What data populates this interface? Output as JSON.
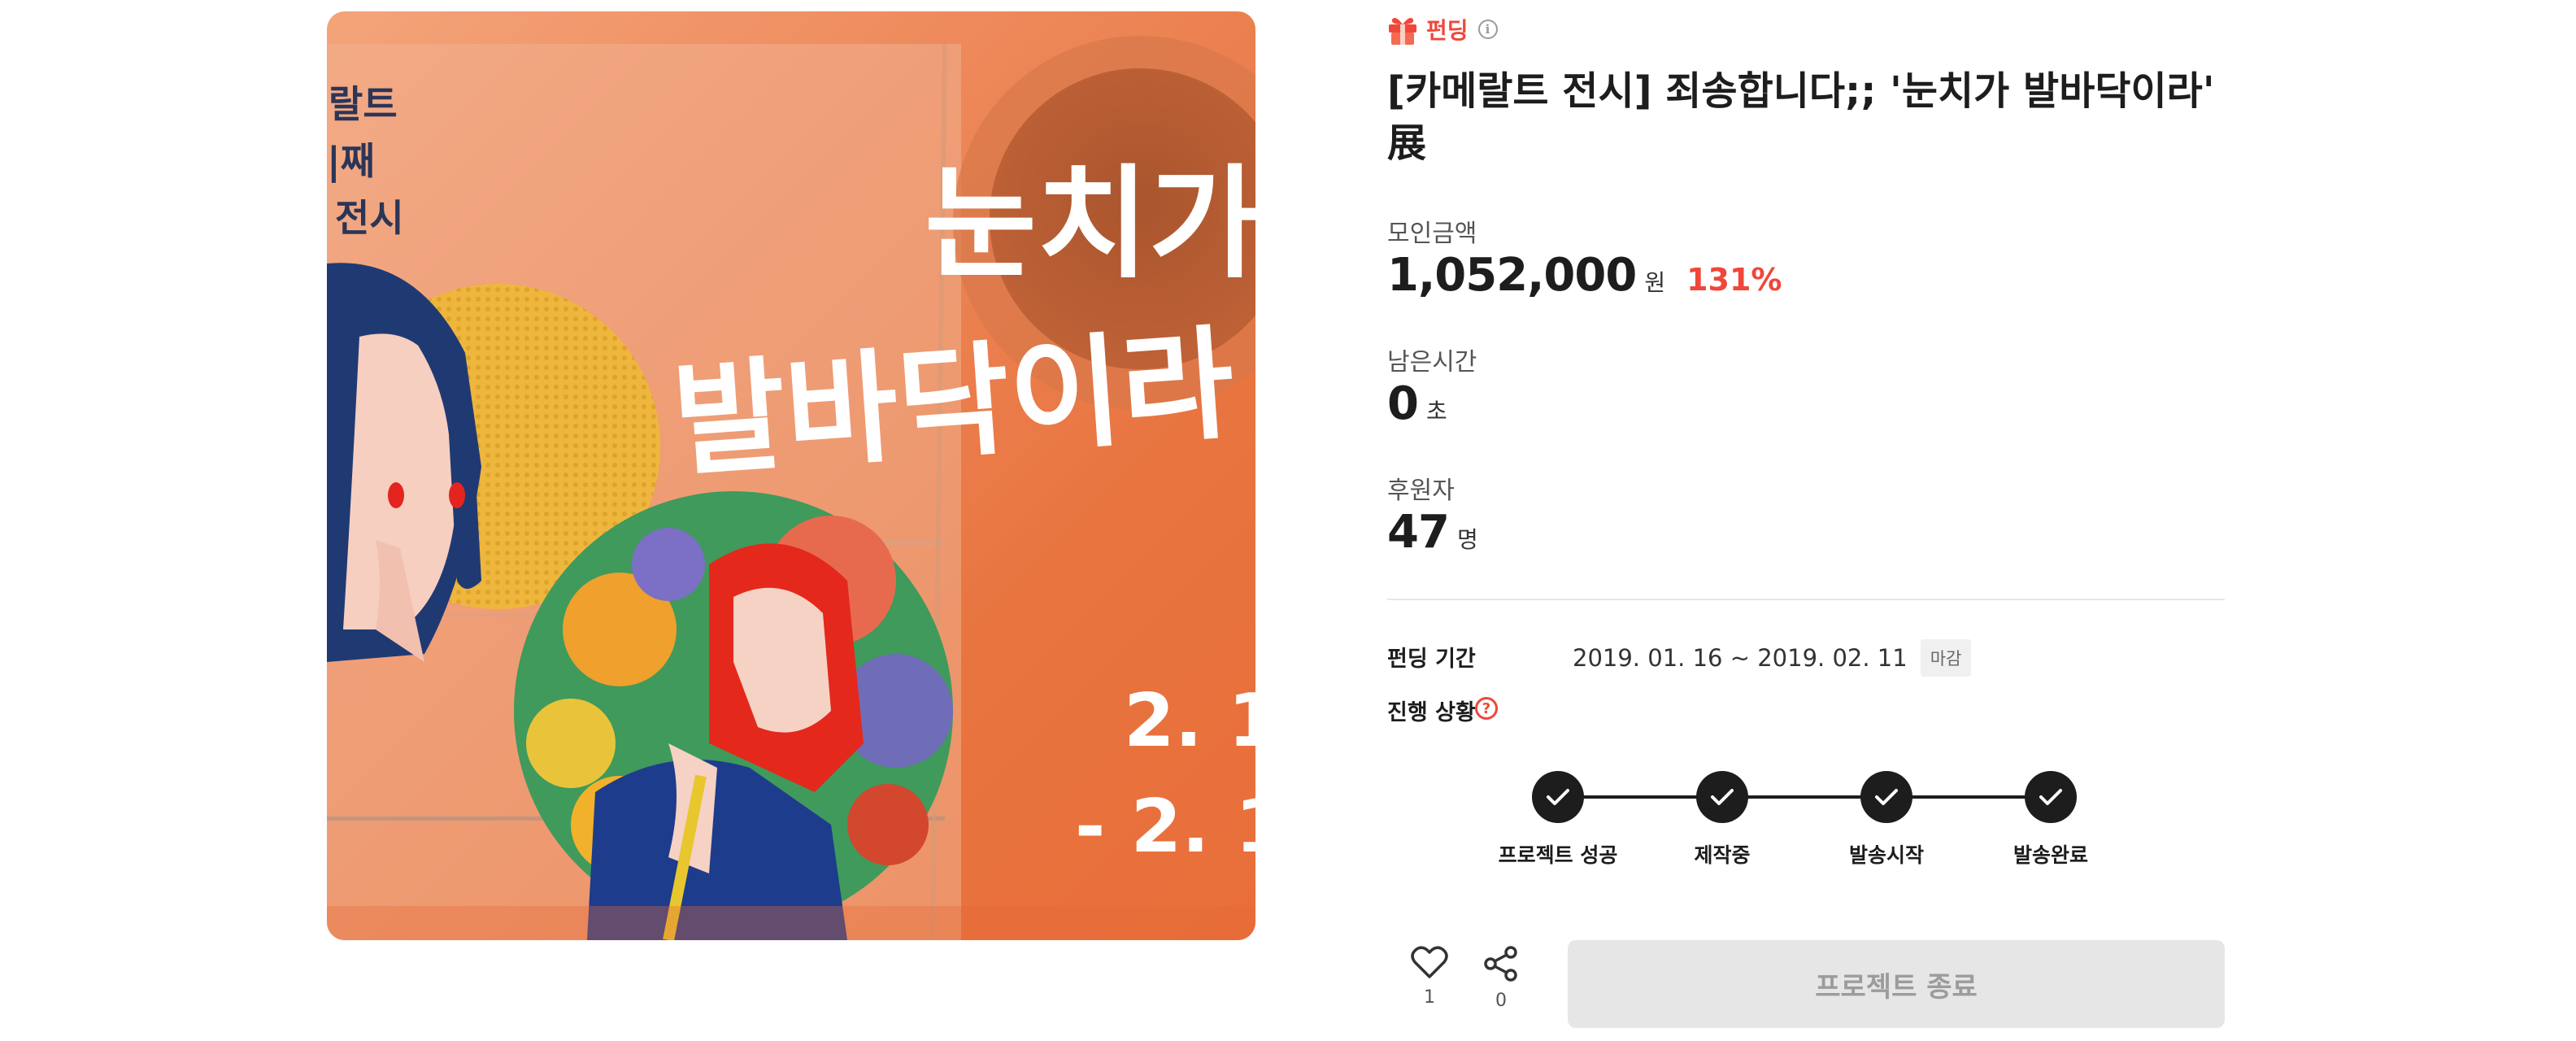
{
  "hero": {
    "big_line1": "눈치가",
    "big_line2": "발바닥이라",
    "small_lines": [
      "랄트",
      "|째",
      "전시"
    ],
    "dates": [
      "2. 1",
      "- 2. 1"
    ]
  },
  "badge": {
    "label": "펀딩",
    "info": "i"
  },
  "title": "[카메랄트 전시] 죄송합니다;; '눈치가 발바닥이라' 展",
  "stats": {
    "amount": {
      "label": "모인금액",
      "value": "1,052,000",
      "unit": "원",
      "percent": "131%"
    },
    "time": {
      "label": "남은시간",
      "value": "0",
      "unit": "초"
    },
    "backers": {
      "label": "후원자",
      "value": "47",
      "unit": "명"
    }
  },
  "period": {
    "label": "펀딩 기간",
    "value": "2019. 01. 16 ~ 2019. 02. 11",
    "tag": "마감"
  },
  "status": {
    "label": "진행 상황",
    "help": "?",
    "steps": [
      "프로젝트 성공",
      "제작중",
      "발송시작",
      "발송완료"
    ]
  },
  "actions": {
    "like_count": "1",
    "share_count": "0",
    "end_button": "프로젝트 종료"
  },
  "colors": {
    "accent": "#f0473b",
    "dark": "#1d1d1d",
    "button_bg": "#e6e6e6"
  }
}
